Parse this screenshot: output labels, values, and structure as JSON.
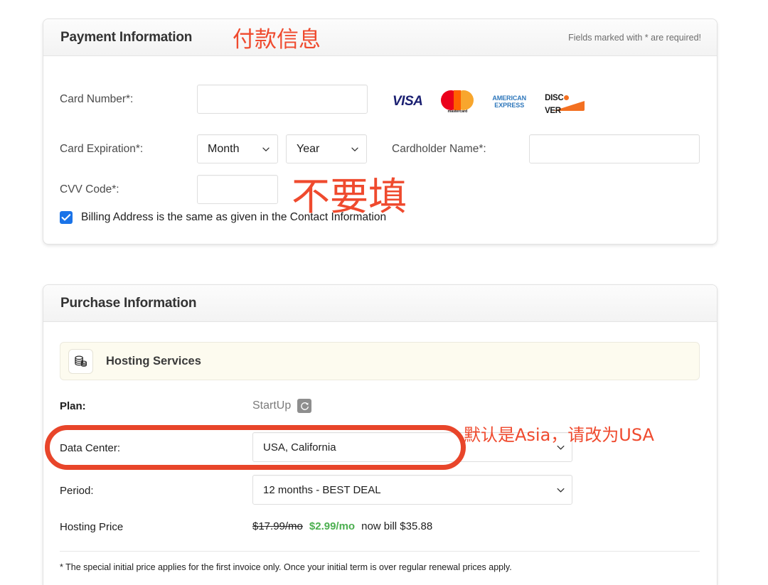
{
  "payment": {
    "title": "Payment Information",
    "annotation_cjk": "付款信息",
    "required_note": "Fields marked with * are required!",
    "card_number_label": "Card Number*:",
    "card_number_value": "",
    "card_expiration_label": "Card Expiration*:",
    "month_select_value": "Month",
    "year_select_value": "Year",
    "cardholder_label": "Cardholder Name*:",
    "cardholder_value": "",
    "cvv_label": "CVV Code*:",
    "cvv_value": "",
    "cvv_annotation_cjk": "不要填",
    "billing_checkbox_label": "Billing Address is the same as given in the Contact Information",
    "billing_checkbox_checked": true,
    "card_brands": [
      {
        "name": "visa",
        "label": "VISA"
      },
      {
        "name": "mastercard",
        "label": "mastercard"
      },
      {
        "name": "american-express",
        "label_line1": "AMERICAN",
        "label_line2": "EXPRESS"
      },
      {
        "name": "discover",
        "label_before": "DISC",
        "label_after": "VER"
      }
    ]
  },
  "purchase": {
    "title": "Purchase Information",
    "service_banner_title": "Hosting Services",
    "service_banner_icon": "coins-stack-icon",
    "plan_label": "Plan:",
    "plan_value": "StartUp",
    "plan_change_icon": "refresh-icon",
    "datacenter_label": "Data Center:",
    "datacenter_value": "USA, California",
    "datacenter_annotation_cjk": "默认是Asia，请改为USA",
    "period_label": "Period:",
    "period_value": "12 months - BEST DEAL",
    "hosting_price_label": "Hosting Price",
    "price_old": "$17.99/mo",
    "price_new": "$2.99/mo",
    "price_bill": "now bill $35.88",
    "footnote": "* The special initial price applies for the first invoice only. Once your initial term is over regular renewal prices apply."
  },
  "colors": {
    "annotation_red": "#ef4a2e",
    "highlight_red": "#e8452a",
    "price_green": "#4caf50",
    "checkbox_blue": "#1a73e8",
    "banner_cream": "#fdfbef"
  }
}
